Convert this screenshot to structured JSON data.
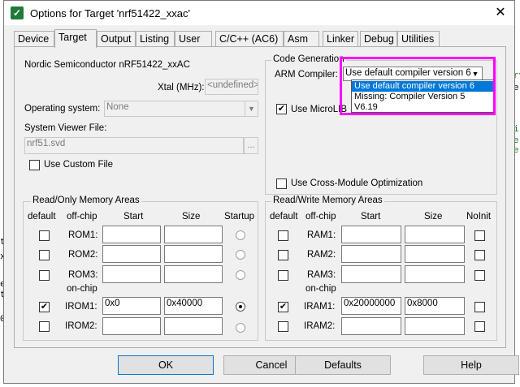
{
  "window": {
    "title": "Options for Target 'nrf51422_xxac'",
    "close": "✕"
  },
  "tabs": [
    "Device",
    "Target",
    "Output",
    "Listing",
    "User",
    "C/C++ (AC6)",
    "Asm",
    "Linker",
    "Debug",
    "Utilities"
  ],
  "device": {
    "name": "Nordic Semiconductor nRF51422_xxAC",
    "xtal_label": "Xtal (MHz):",
    "xtal_value": "<undefined>",
    "os_label": "Operating system:",
    "os_value": "None",
    "svd_label": "System Viewer File:",
    "svd_value": "nrf51.svd",
    "browse": "...",
    "custom_file": "Use Custom File"
  },
  "codegen": {
    "title": "Code Generation",
    "compiler_label": "ARM Compiler:",
    "compiler_value": "Use default compiler version 6",
    "options": [
      "Use default compiler version 6",
      "Missing: Compiler Version 5",
      "V6.19"
    ],
    "microlib": "Use MicroLIB",
    "cross_module": "Use Cross-Module Optimization"
  },
  "rom": {
    "title": "Read/Only Memory Areas",
    "headers": [
      "default",
      "off-chip",
      "Start",
      "Size",
      "Startup"
    ],
    "onchip": "on-chip",
    "rows": [
      {
        "label": "ROM1:",
        "start": "",
        "size": ""
      },
      {
        "label": "ROM2:",
        "start": "",
        "size": ""
      },
      {
        "label": "ROM3:",
        "start": "",
        "size": ""
      },
      {
        "label": "IROM1:",
        "start": "0x0",
        "size": "0x40000"
      },
      {
        "label": "IROM2:",
        "start": "",
        "size": ""
      }
    ]
  },
  "ram": {
    "title": "Read/Write Memory Areas",
    "headers": [
      "default",
      "off-chip",
      "Start",
      "Size",
      "NoInit"
    ],
    "onchip": "on-chip",
    "rows": [
      {
        "label": "RAM1:",
        "start": "",
        "size": ""
      },
      {
        "label": "RAM2:",
        "start": "",
        "size": ""
      },
      {
        "label": "RAM3:",
        "start": "",
        "size": ""
      },
      {
        "label": "IRAM1:",
        "start": "0x20000000",
        "size": "0x8000"
      },
      {
        "label": "IRAM2:",
        "start": "",
        "size": ""
      }
    ]
  },
  "buttons": {
    "ok": "OK",
    "cancel": "Cancel",
    "defaults": "Defaults",
    "help": "Help"
  },
  "colors": {
    "highlight": "#ff00ff",
    "selection": "#0078d7"
  }
}
